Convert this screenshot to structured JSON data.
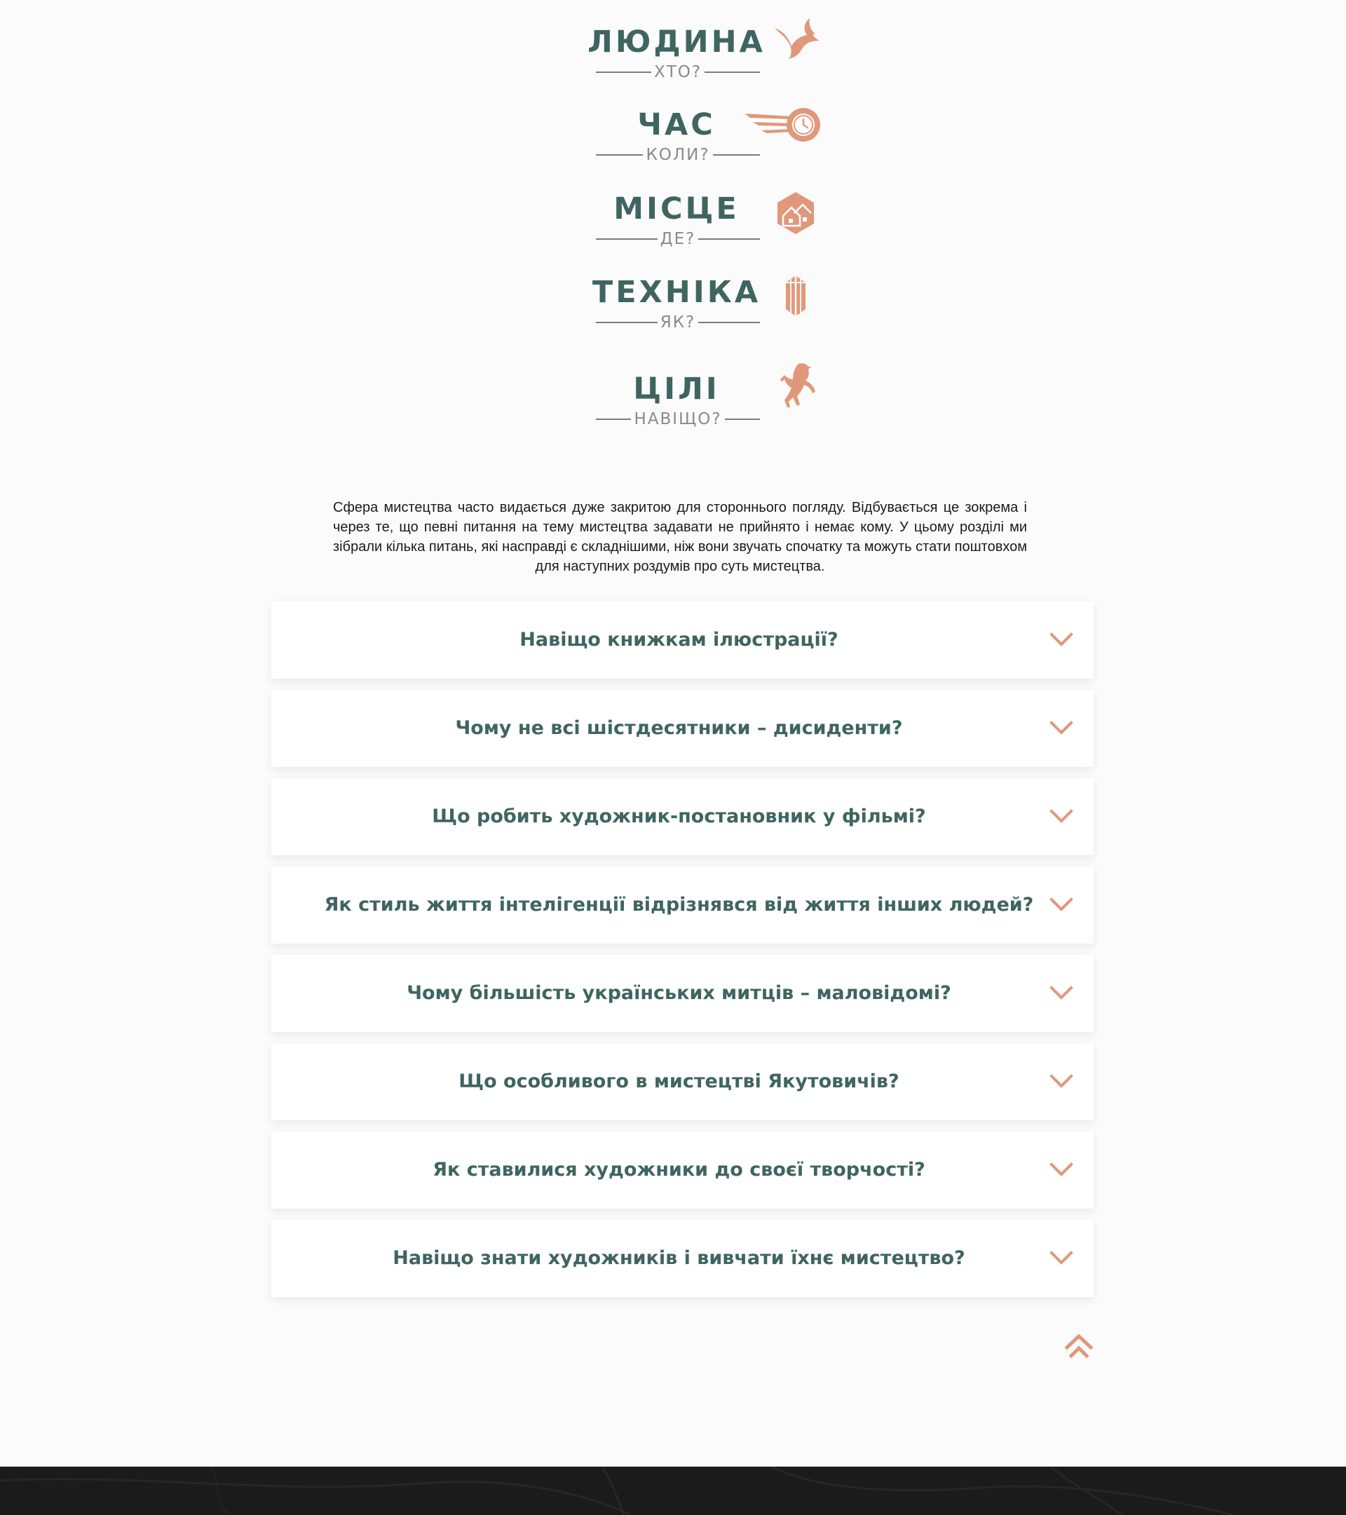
{
  "categories": [
    {
      "title": "ЛЮДИНА",
      "sub": "ХТО?",
      "icon": "swallow-icon"
    },
    {
      "title": "ЧАС",
      "sub": "КОЛИ?",
      "icon": "flying-clock-icon"
    },
    {
      "title": "МІСЦЕ",
      "sub": "ДЕ?",
      "icon": "houses-hexagon-icon"
    },
    {
      "title": "ТЕХНІКА",
      "sub": "ЯК?",
      "icon": "crystal-icon"
    },
    {
      "title": "ЦІЛІ",
      "sub": "НАВІЩО?",
      "icon": "rearing-horse-icon"
    }
  ],
  "intro": "Сфера мистецтва часто видається дуже закритою для стороннього погляду. Відбувається це зокрема і через те, що певні питання на тему мистецтва задавати не прийнято і немає кому. У цьому розділі ми зібрали кілька питань, які насправді є складнішими, ніж вони звучать спочатку та можуть стати поштовхом для наступних роздумів про суть мистецтва.",
  "faq": [
    "Навіщо книжкам ілюстрації?",
    "Чому не всі шістдесятники – дисиденти?",
    "Що робить художник-постановник у фільмі?",
    "Як стиль життя інтелігенції відрізнявся від життя інших людей?",
    "Чому більшість українських митців – маловідомі?",
    "Що особливого в мистецтві Якутовичів?",
    "Як ставилися художники до своєї творчості?",
    "Навіщо знати художників і вивчати їхнє мистецтво?"
  ],
  "colors": {
    "accent": "#e0987a",
    "heading": "#3f6561",
    "muted": "#8a8a8a",
    "footer": "#1b1b1b"
  },
  "icons": {
    "chevron": "chevron-down-icon",
    "scroll_top": "double-chevron-up-icon"
  }
}
